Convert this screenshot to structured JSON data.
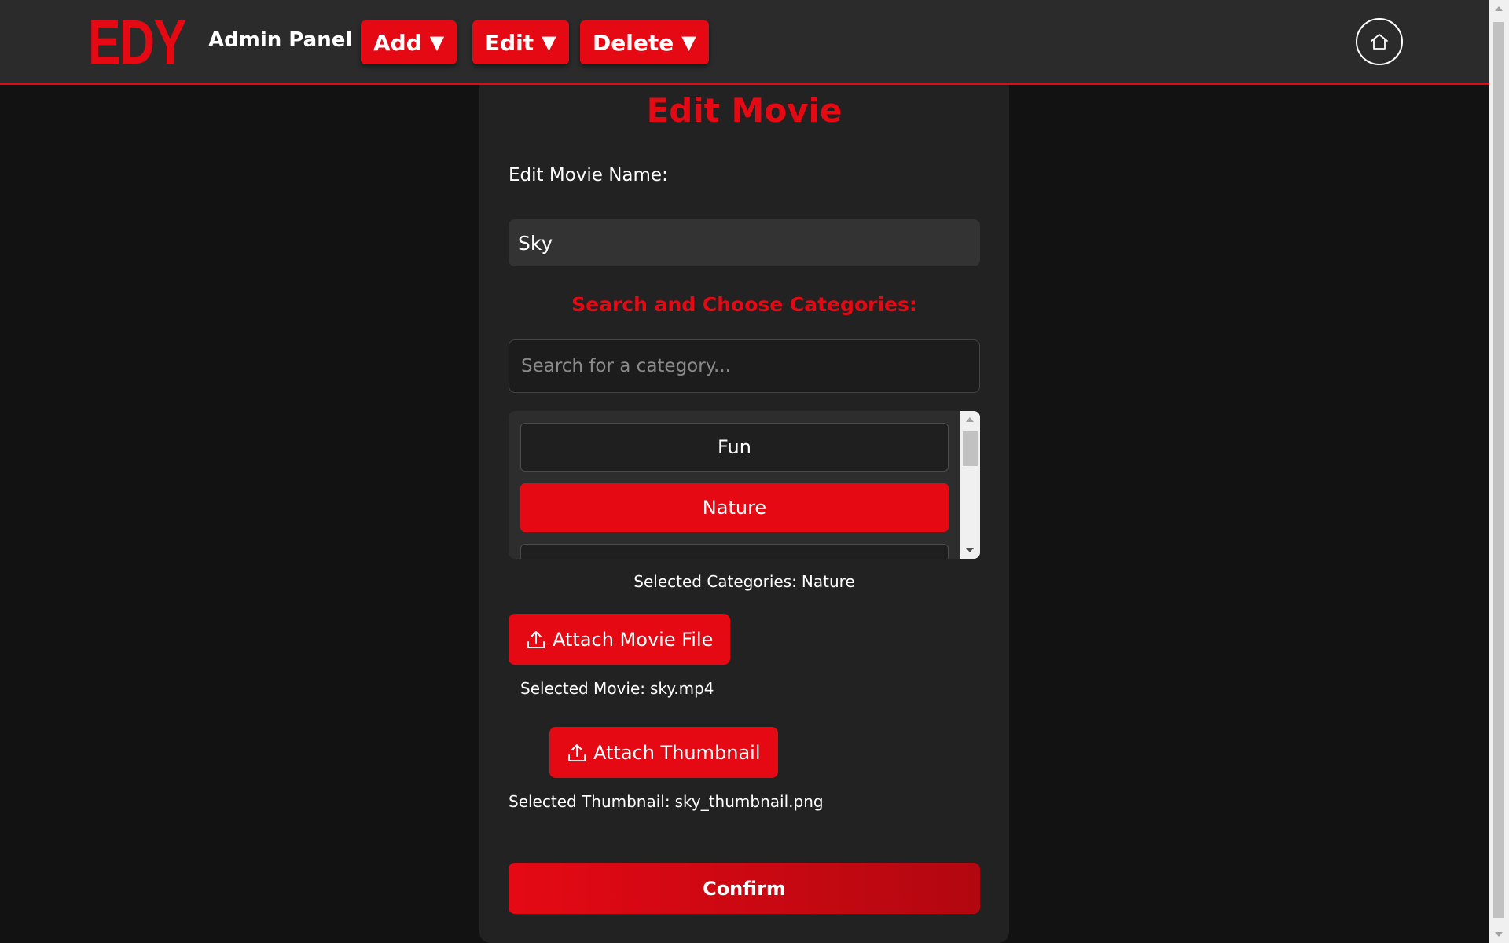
{
  "header": {
    "logo_text": "EDY",
    "title": "Admin Panel",
    "nav": [
      {
        "label": "Add",
        "caret": "▼"
      },
      {
        "label": "Edit",
        "caret": "▼"
      },
      {
        "label": "Delete",
        "caret": "▼"
      }
    ],
    "home_icon": "home-icon"
  },
  "form": {
    "title": "Edit Movie",
    "name_label": "Edit Movie Name:",
    "name_value": "Sky",
    "categories_heading": "Search and Choose Categories:",
    "search_placeholder": "Search for a category...",
    "category_items": [
      {
        "label": "Fun",
        "selected": false
      },
      {
        "label": "Nature",
        "selected": true
      }
    ],
    "selected_categories_label": "Selected Categories:",
    "selected_categories_value": "Nature",
    "attach_movie_label": "Attach Movie File",
    "selected_movie_label": "Selected Movie:",
    "selected_movie_value": "sky.mp4",
    "attach_thumbnail_label": "Attach Thumbnail",
    "selected_thumbnail_label": "Selected Thumbnail:",
    "selected_thumbnail_value": "sky_thumbnail.png",
    "confirm_label": "Confirm",
    "upload_icon": "upload-icon"
  },
  "colors": {
    "accent": "#e50914",
    "background": "#121212",
    "card": "#222222",
    "header": "#2b2b2b"
  }
}
